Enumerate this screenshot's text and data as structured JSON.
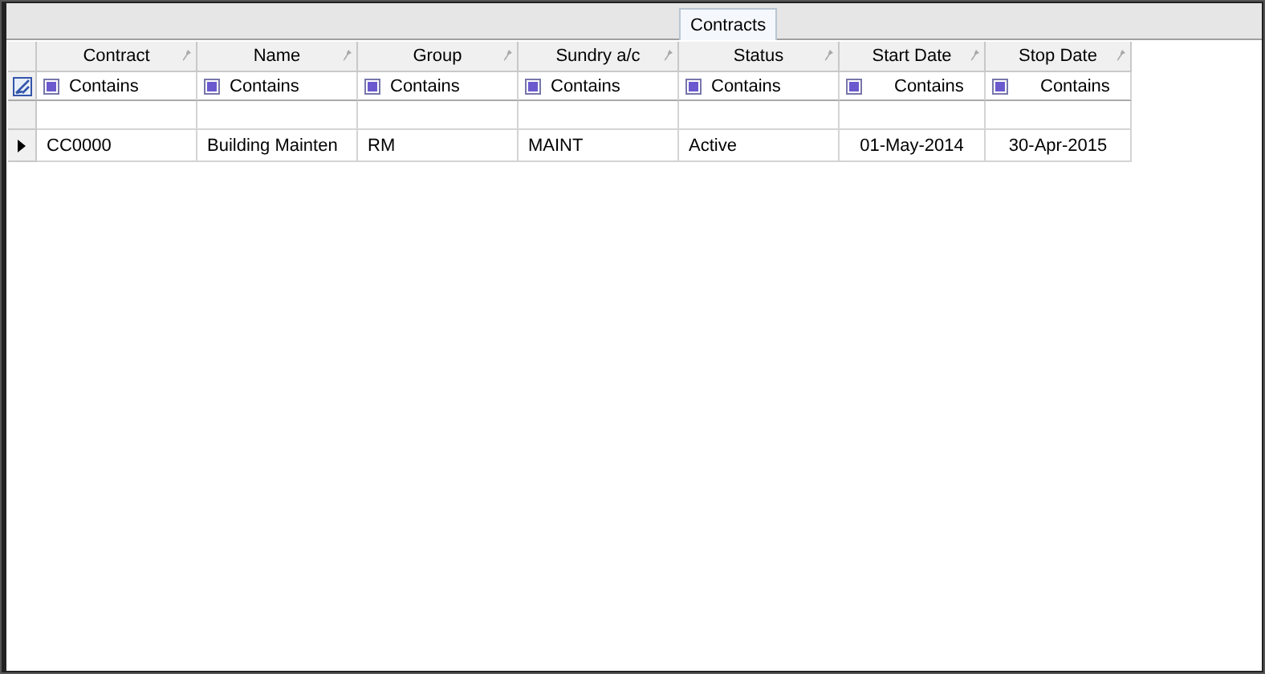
{
  "tabs": [
    {
      "label": "Contracts",
      "selected": true
    }
  ],
  "table": {
    "columns": [
      {
        "title": "Contract",
        "kind": "text",
        "filter": "Contains"
      },
      {
        "title": "Name",
        "kind": "text",
        "filter": "Contains"
      },
      {
        "title": "Group",
        "kind": "text",
        "filter": "Contains"
      },
      {
        "title": "Sundry a/c",
        "kind": "text",
        "filter": "Contains"
      },
      {
        "title": "Status",
        "kind": "text",
        "filter": "Contains"
      },
      {
        "title": "Start Date",
        "kind": "date",
        "filter": "Contains"
      },
      {
        "title": "Stop Date",
        "kind": "date",
        "filter": "Contains"
      }
    ],
    "rows": [
      {
        "selected": true,
        "cells": [
          "CC0000",
          "Building Mainten",
          "RM",
          "MAINT",
          "Active",
          "01-May-2014",
          "30-Apr-2015"
        ]
      }
    ]
  }
}
